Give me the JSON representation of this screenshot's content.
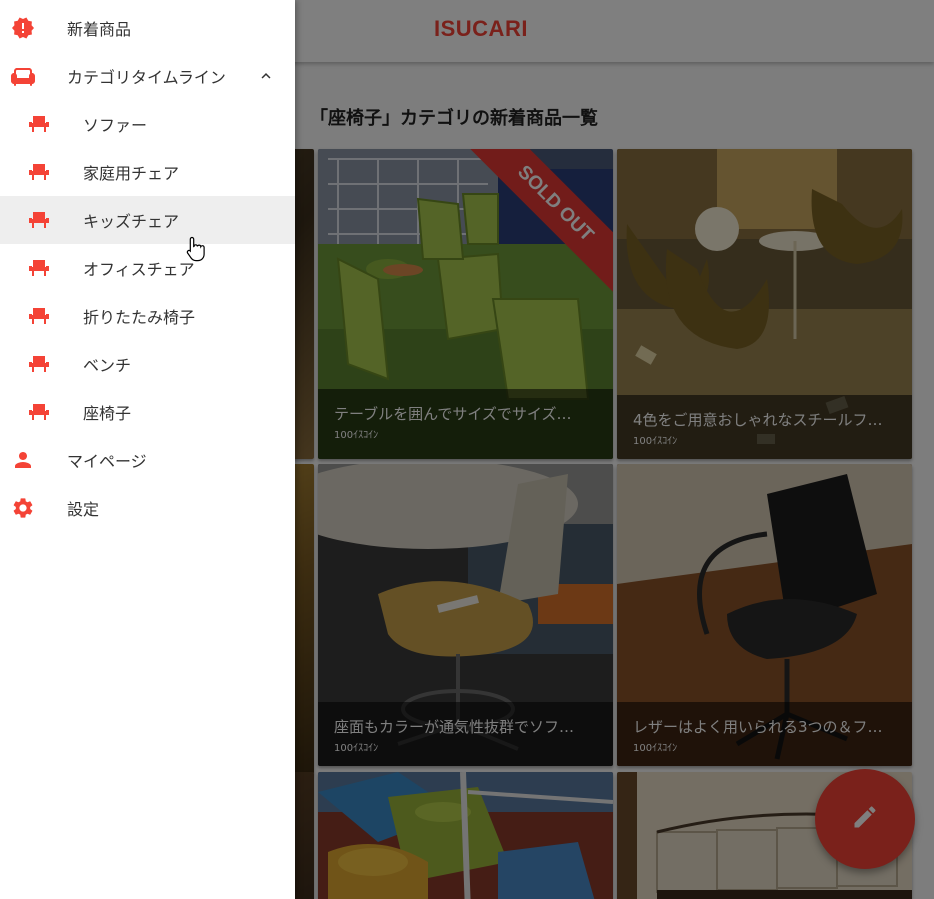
{
  "app": {
    "title": "ISUCARI"
  },
  "page": {
    "heading": "「座椅子」カテゴリの新着商品一覧"
  },
  "items": [
    {
      "name": "テーブルを囲んでサイズでサイズ…",
      "price": "100ｲｽｺｲﾝ",
      "sold_out": true,
      "sold_label": "SOLD OUT"
    },
    {
      "name": "4色をご用意おしゃれなスチールフ…",
      "price": "100ｲｽｺｲﾝ",
      "sold_out": false
    },
    {
      "name": "座面もカラーが通気性抜群でソフ…",
      "price": "100ｲｽｺｲﾝ",
      "sold_out": false
    },
    {
      "name": "レザーはよく用いられる3つの＆フ…",
      "price": "100ｲｽｺｲﾝ",
      "sold_out": false
    }
  ],
  "drawer": {
    "items": [
      {
        "label": "新着商品",
        "icon": "new-releases-icon",
        "level": "top"
      },
      {
        "label": "カテゴリタイムライン",
        "icon": "sofa-icon",
        "level": "top",
        "expanded": true
      },
      {
        "label": "ソファー",
        "icon": "chair-icon",
        "level": "sub"
      },
      {
        "label": "家庭用チェア",
        "icon": "chair-icon",
        "level": "sub"
      },
      {
        "label": "キッズチェア",
        "icon": "chair-icon",
        "level": "sub",
        "hovered": true
      },
      {
        "label": "オフィスチェア",
        "icon": "chair-icon",
        "level": "sub"
      },
      {
        "label": "折りたたみ椅子",
        "icon": "chair-icon",
        "level": "sub"
      },
      {
        "label": "ベンチ",
        "icon": "chair-icon",
        "level": "sub"
      },
      {
        "label": "座椅子",
        "icon": "chair-icon",
        "level": "sub"
      },
      {
        "label": "マイページ",
        "icon": "person-icon",
        "level": "top"
      },
      {
        "label": "設定",
        "icon": "gear-icon",
        "level": "top"
      }
    ]
  },
  "fab": {
    "icon": "edit-pencil-icon"
  },
  "colors": {
    "accent": "#f44336",
    "overlay": "rgba(0,0,0,0.5)"
  }
}
